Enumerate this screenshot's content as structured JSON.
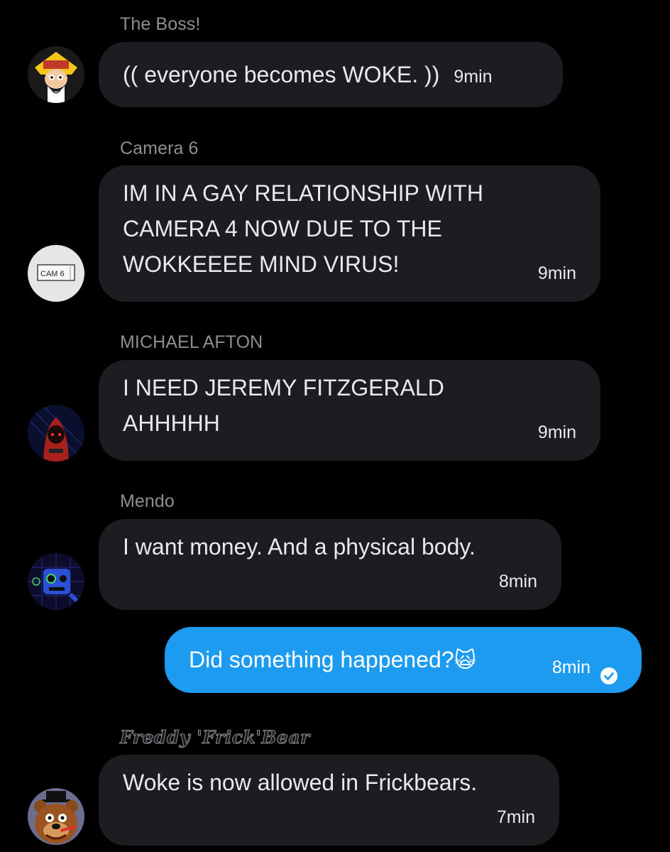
{
  "colors": {
    "background": "#000000",
    "incoming_bubble": "#1c1d20",
    "outgoing_bubble": "#1d9bf0",
    "sender_name": "#8b8f94",
    "text": "#e7e9ea"
  },
  "messages": [
    {
      "sender": "The Boss!",
      "text": "(( everyone becomes WOKE. ))",
      "time": "9min",
      "avatar_icon": "the-boss-avatar"
    },
    {
      "sender": "Camera 6",
      "text": "IM IN A GAY RELATIONSHIP WITH\nCAMERA 4 NOW DUE TO THE\nWOKKEEEE MIND VIRUS!",
      "time": "9min",
      "avatar_icon": "camera-6-avatar",
      "avatar_label": "CAM 6"
    },
    {
      "sender": "MICHAEL AFTON",
      "text": "I NEED JEREMY FITZGERALD\nAHHHHH",
      "time": "9min",
      "avatar_icon": "michael-afton-avatar"
    },
    {
      "sender": "Mendo",
      "text": "I want money. And a physical body.",
      "time": "8min",
      "avatar_icon": "mendo-avatar"
    },
    {
      "sender": "Freddy 'Frick'Bear",
      "text": "Woke is now allowed in Frickbears.",
      "time": "7min",
      "avatar_icon": "freddy-frickbear-avatar"
    }
  ],
  "outgoing": {
    "text": "Did something happened?",
    "emoji": "🙀",
    "time": "8min",
    "status_icon": "read-check-icon"
  }
}
